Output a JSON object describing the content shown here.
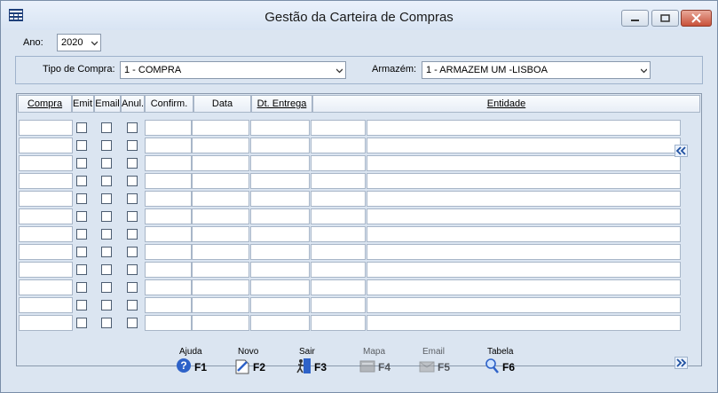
{
  "window": {
    "title": "Gestão da Carteira de Compras"
  },
  "filters": {
    "ano_label": "Ano:",
    "ano_value": "2020",
    "tipo_label": "Tipo de Compra:",
    "tipo_value": "1 - COMPRA",
    "armazem_label": "Armazém:",
    "armazem_value": "1 - ARMAZEM UM -LISBOA"
  },
  "grid": {
    "columns": [
      "Compra",
      "Emit.",
      "Email",
      "Anul.",
      "Confirm.",
      "Data",
      "Dt. Entrega",
      "Entidade"
    ],
    "row_count": 12
  },
  "toolbar": {
    "buttons": [
      {
        "caption": "Ajuda",
        "key": "F1",
        "icon": "help-icon",
        "enabled": true
      },
      {
        "caption": "Novo",
        "key": "F2",
        "icon": "new-document-icon",
        "enabled": true
      },
      {
        "caption": "Sair",
        "key": "F3",
        "icon": "exit-icon",
        "enabled": true
      },
      {
        "caption": "Mapa",
        "key": "F4",
        "icon": "map-icon",
        "enabled": false
      },
      {
        "caption": "Email",
        "key": "F5",
        "icon": "email-icon",
        "enabled": false
      },
      {
        "caption": "Tabela",
        "key": "F6",
        "icon": "table-search-icon",
        "enabled": true
      }
    ]
  }
}
